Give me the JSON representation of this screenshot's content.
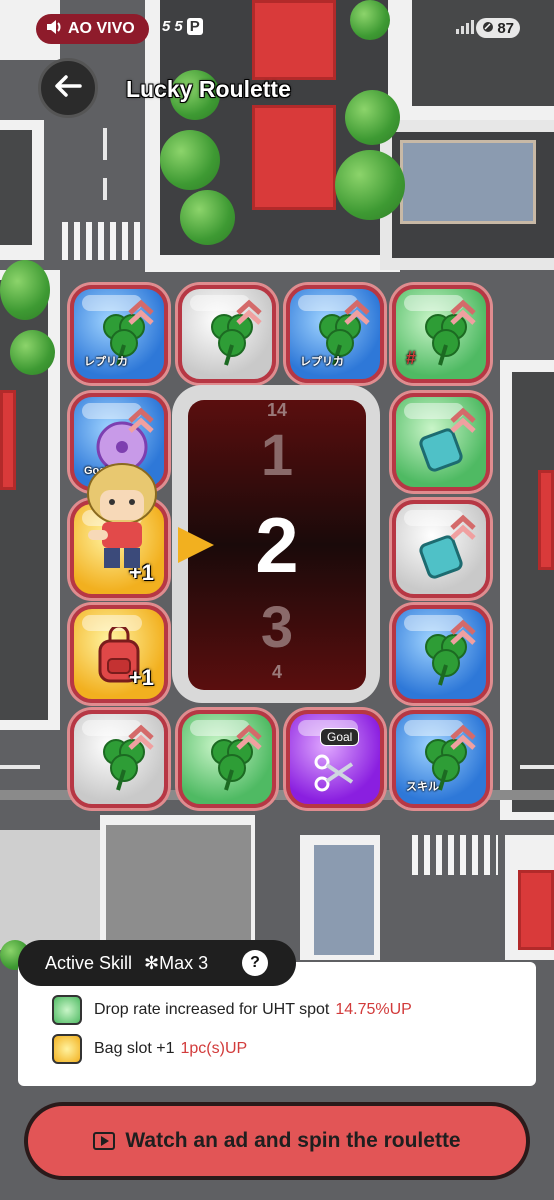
{
  "status_bar": {
    "live_label": "AO VIVO",
    "app_icons": [
      "5",
      "5",
      "P"
    ],
    "battery": "87"
  },
  "header": {
    "title": "Lucky Roulette"
  },
  "board": {
    "tile_labels": {
      "replica": "レプリカ",
      "goal": "Goal",
      "skill": "スキル",
      "plus_one": "+1"
    },
    "roulette_numbers": [
      "14",
      "1",
      "2",
      "3",
      "4"
    ],
    "current_number": "2"
  },
  "active_skill": {
    "title": "Active Skill",
    "max_label": "✻Max 3",
    "help": "?",
    "items": [
      {
        "text": "Drop rate increased for UHT spot",
        "value": "14.75%UP",
        "icon": "clover-icon"
      },
      {
        "text": "Bag slot +1",
        "value": "1pc(s)UP",
        "icon": "backpack-icon"
      }
    ]
  },
  "cta": {
    "label": "Watch an ad and spin the roulette"
  },
  "colors": {
    "accent": "#e25556",
    "highlight": "#d23b3b",
    "live_badge": "#8e1b2b"
  }
}
